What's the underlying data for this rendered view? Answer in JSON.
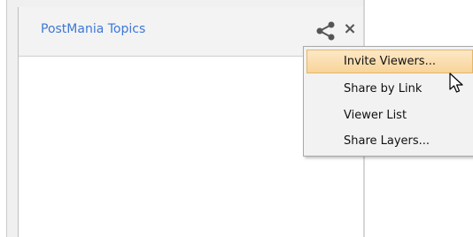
{
  "panel": {
    "title": "PostMania Topics",
    "icons": {
      "share": "share-icon",
      "close": "close-icon"
    },
    "close_glyph": "×"
  },
  "menu": {
    "items": [
      {
        "label": "Invite Viewers...",
        "highlighted": true
      },
      {
        "label": "Share by Link",
        "highlighted": false
      },
      {
        "label": "Viewer List",
        "highlighted": false
      },
      {
        "label": "Share Layers...",
        "highlighted": false
      }
    ]
  },
  "colors": {
    "title": "#3d78d6",
    "menu_highlight": "#f8d499",
    "menu_highlight_border": "#e4b66b"
  }
}
